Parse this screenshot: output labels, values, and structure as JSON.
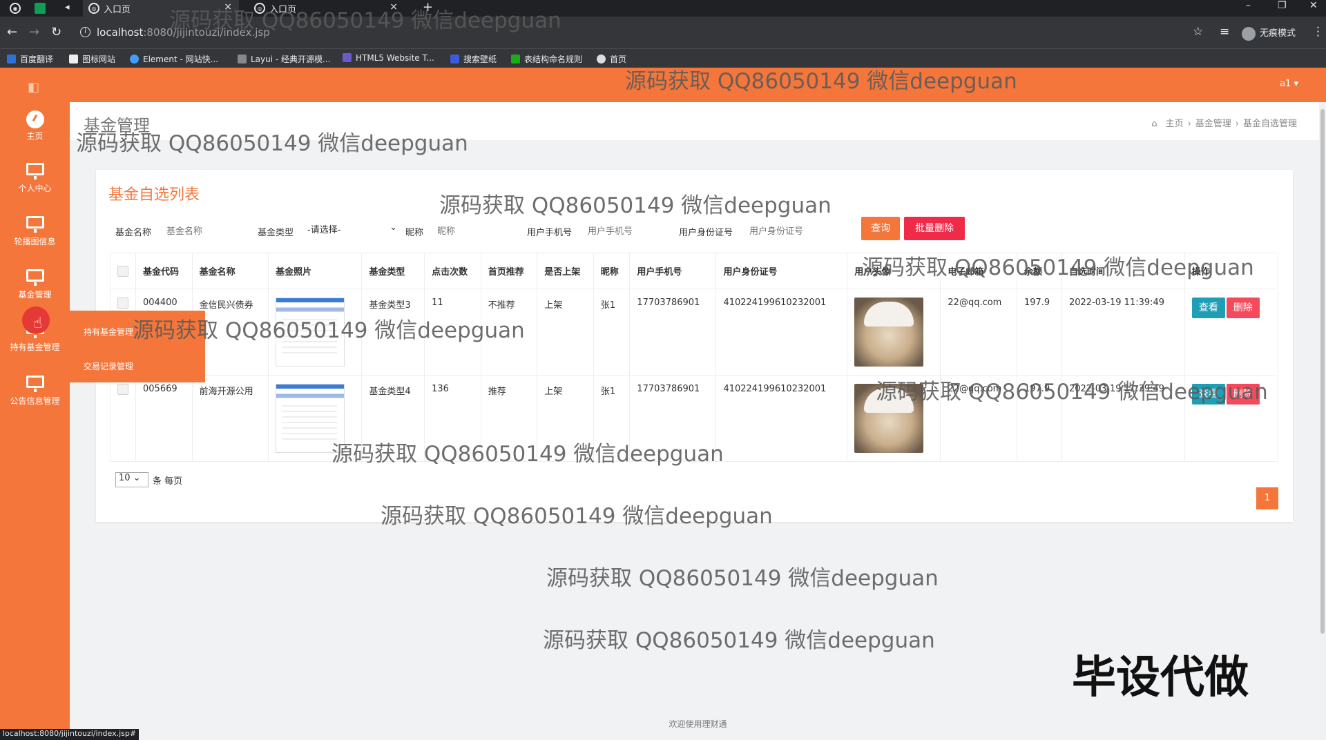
{
  "browser": {
    "tabs": [
      {
        "label": "入口页"
      },
      {
        "label": "入口页"
      }
    ],
    "url_host": "localhost",
    "url_path": ":8080/jijintouzi/index.jsp",
    "incognito_label": "无痕模式",
    "bookmarks": [
      "百度翻译",
      "图标网站",
      "Element - 网站快...",
      "Layui - 经典开源模...",
      "HTML5 Website T...",
      "搜索壁纸",
      "表结构命名规则",
      "首页"
    ],
    "status_url": "localhost:8080/jijintouzi/index.jsp#"
  },
  "sidebar": {
    "items": [
      {
        "label": "主页"
      },
      {
        "label": "个人中心"
      },
      {
        "label": "轮播图信息"
      },
      {
        "label": "基金管理"
      },
      {
        "label": "持有基金管理"
      },
      {
        "label": "公告信息管理"
      }
    ],
    "submenu": [
      "持有基金管理",
      "交易记录管理"
    ]
  },
  "topbar": {
    "user": "a1"
  },
  "page": {
    "title": "基金管理",
    "breadcrumb": [
      "主页",
      "基金管理",
      "基金自选管理"
    ]
  },
  "panel": {
    "title": "基金自选列表",
    "filters": {
      "fund_name_label": "基金名称",
      "fund_name_placeholder": "基金名称",
      "fund_type_label": "基金类型",
      "fund_type_value": "-请选择-",
      "nickname_label": "昵称",
      "nickname_placeholder": "昵称",
      "phone_label": "用户手机号",
      "phone_placeholder": "用户手机号",
      "idcard_label": "用户身份证号",
      "idcard_placeholder": "用户身份证号"
    },
    "buttons": {
      "query": "查询",
      "batch_delete": "批量删除",
      "view": "查看",
      "delete": "删除"
    },
    "columns": [
      "基金代码",
      "基金名称",
      "基金照片",
      "基金类型",
      "点击次数",
      "首页推荐",
      "是否上架",
      "昵称",
      "用户手机号",
      "用户身份证号",
      "用户头像",
      "电子邮箱",
      "余额",
      "自选时间",
      "操作"
    ],
    "rows": [
      {
        "code": "004400",
        "name": "金信民兴债券",
        "type": "基金类型3",
        "clicks": "11",
        "recommend": "不推荐",
        "onsale": "上架",
        "nick": "张1",
        "phone": "17703786901",
        "idcard": "410224199610232001",
        "email": "22@qq.com",
        "balance": "197.9",
        "time": "2022-03-19 11:39:49"
      },
      {
        "code": "005669",
        "name": "前海开源公用",
        "type": "基金类型4",
        "clicks": "136",
        "recommend": "推荐",
        "onsale": "上架",
        "nick": "张1",
        "phone": "17703786901",
        "idcard": "410224199610232001",
        "email": "22@qq.com",
        "balance": "197.9",
        "time": "2022-03-19 11:39:49"
      }
    ],
    "pager": {
      "page_size": "10",
      "per_page_label": "条 每页",
      "current": "1"
    }
  },
  "footer": "欢迎使用理财通",
  "watermark": "源码获取 QQ86050149 微信deepguan",
  "big_text": "毕设代做",
  "colors": {
    "accent": "#f5763a",
    "view_btn": "#1e9fb5",
    "delete_btn": "#f44a5c",
    "query_btn": "#f5763a",
    "batch_btn": "#f02b4a"
  }
}
